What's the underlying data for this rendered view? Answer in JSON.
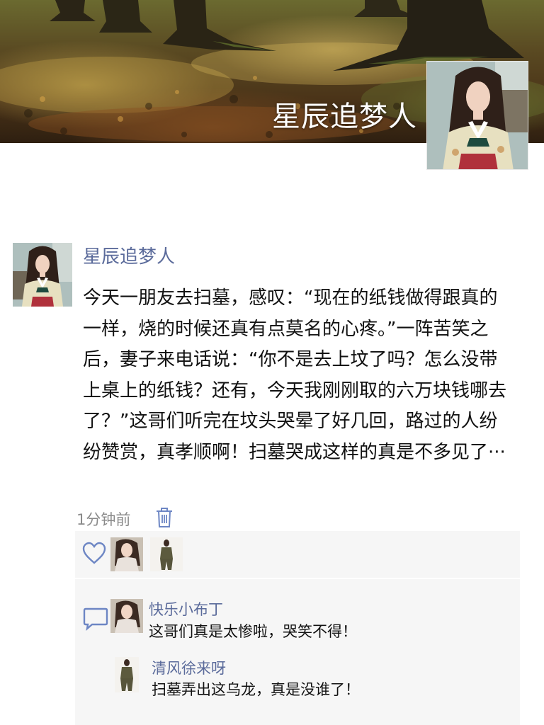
{
  "header": {
    "cover_alt": "forest-cover-photo",
    "profile_name": "星辰追梦人"
  },
  "post": {
    "author": "星辰追梦人",
    "content": "今天一朋友去扫墓，感叹：“现在的纸钱做得跟真的一样，烧的时候还真有点莫名的心疼。”一阵苦笑之后，妻子来电话说：“你不是去上坟了吗？怎么没带上桌上的纸钱？还有，今天我刚刚取的六万块钱哪去了？”这哥们听完在坟头哭晕了好几回，路过的人纷纷赞赏，真孝顺啊！扫墓哭成这样的真是不多见了···",
    "time": "1分钟前"
  },
  "likes": {
    "icon": "heart-icon",
    "users": [
      "user-1",
      "user-2"
    ]
  },
  "comments": [
    {
      "name": "快乐小布丁",
      "text": "这哥们真是太惨啦，哭笑不得！"
    },
    {
      "name": "清风徐来呀",
      "text": "扫墓弄出这乌龙，真是没谁了！"
    }
  ],
  "colors": {
    "link": "#5b6b9b",
    "text": "#111111",
    "muted": "#8a8a8a",
    "panel": "#f6f6f6",
    "icon_blue": "#6d86c4"
  }
}
